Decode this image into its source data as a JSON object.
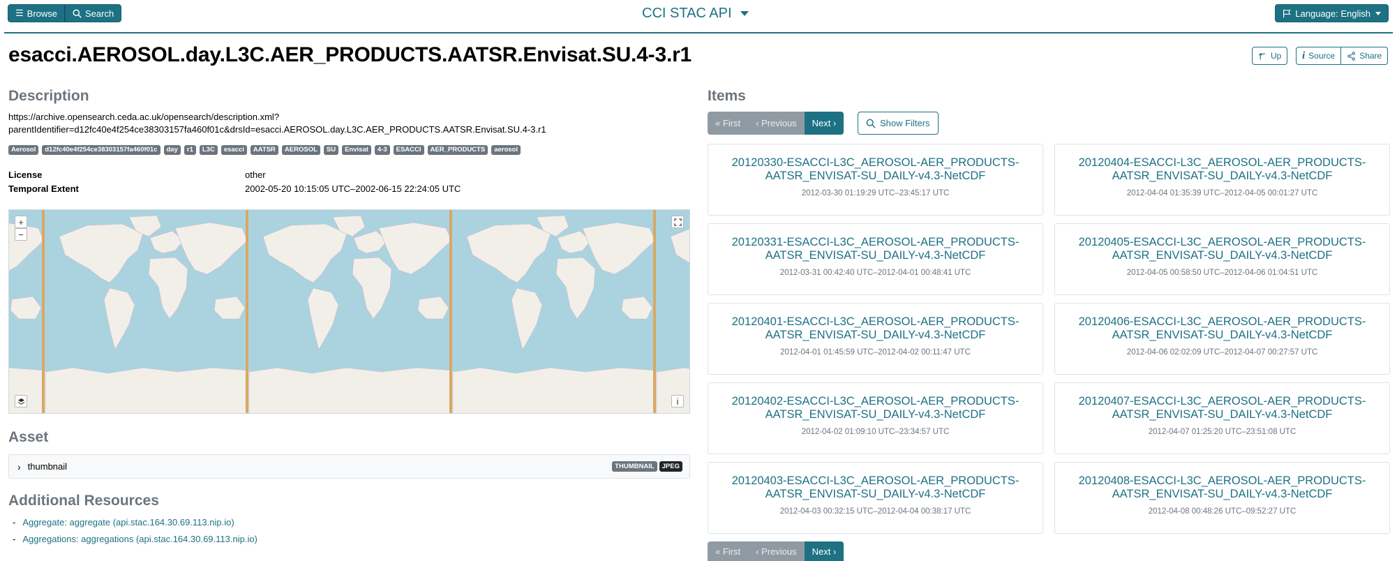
{
  "header": {
    "browse_label": "Browse",
    "search_label": "Search",
    "app_title": "CCI STAC API",
    "language_label": "Language: English"
  },
  "page": {
    "title": "esacci.AEROSOL.day.L3C.AER_PRODUCTS.AATSR.Envisat.SU.4-3.r1",
    "up_label": "Up",
    "source_label": "Source",
    "share_label": "Share"
  },
  "description": {
    "heading": "Description",
    "line1": "https://archive.opensearch.ceda.ac.uk/opensearch/description.xml?",
    "line2": "parentIdentifier=d12fc40e4f254ce38303157fa460f01c&drsId=esacci.AEROSOL.day.L3C.AER_PRODUCTS.AATSR.Envisat.SU.4-3.r1",
    "keywords": [
      "Aerosol",
      "d12fc40e4f254ce38303157fa460f01c",
      "day",
      "r1",
      "L3C",
      "esacci",
      "AATSR",
      "AEROSOL",
      "SU",
      "Envisat",
      "4-3",
      "ESACCI",
      "AER_PRODUCTS",
      "aerosol"
    ]
  },
  "meta": {
    "license_label": "License",
    "license_value": "other",
    "temporal_label": "Temporal Extent",
    "temporal_value": "2002-05-20 10:15:05 UTC–2002-06-15 22:24:05 UTC"
  },
  "map": {
    "zoom_in": "+",
    "zoom_out": "−",
    "info": "i"
  },
  "asset": {
    "heading": "Asset",
    "name": "thumbnail",
    "role_badge": "THUMBNAIL",
    "type_badge": "JPEG"
  },
  "resources": {
    "heading": "Additional Resources",
    "links": [
      "Aggregate: aggregate (api.stac.164.30.69.113.nip.io)",
      "Aggregations: aggregations (api.stac.164.30.69.113.nip.io)"
    ]
  },
  "items": {
    "heading": "Items",
    "first_label": "« First",
    "previous_label": "‹ Previous",
    "next_label": "Next ›",
    "show_filters_label": "Show Filters",
    "list": [
      {
        "title": "20120330-ESACCI-L3C_AEROSOL-AER_PRODUCTS-AATSR_ENVISAT-SU_DAILY-v4.3-NetCDF",
        "time": "2012-03-30 01:19:29 UTC–23:45:17 UTC"
      },
      {
        "title": "20120404-ESACCI-L3C_AEROSOL-AER_PRODUCTS-AATSR_ENVISAT-SU_DAILY-v4.3-NetCDF",
        "time": "2012-04-04 01:35:39 UTC–2012-04-05 00:01:27 UTC"
      },
      {
        "title": "20120331-ESACCI-L3C_AEROSOL-AER_PRODUCTS-AATSR_ENVISAT-SU_DAILY-v4.3-NetCDF",
        "time": "2012-03-31 00:42:40 UTC–2012-04-01 00:48:41 UTC"
      },
      {
        "title": "20120405-ESACCI-L3C_AEROSOL-AER_PRODUCTS-AATSR_ENVISAT-SU_DAILY-v4.3-NetCDF",
        "time": "2012-04-05 00:58:50 UTC–2012-04-06 01:04:51 UTC"
      },
      {
        "title": "20120401-ESACCI-L3C_AEROSOL-AER_PRODUCTS-AATSR_ENVISAT-SU_DAILY-v4.3-NetCDF",
        "time": "2012-04-01 01:45:59 UTC–2012-04-02 00:11:47 UTC"
      },
      {
        "title": "20120406-ESACCI-L3C_AEROSOL-AER_PRODUCTS-AATSR_ENVISAT-SU_DAILY-v4.3-NetCDF",
        "time": "2012-04-06 02:02:09 UTC–2012-04-07 00:27:57 UTC"
      },
      {
        "title": "20120402-ESACCI-L3C_AEROSOL-AER_PRODUCTS-AATSR_ENVISAT-SU_DAILY-v4.3-NetCDF",
        "time": "2012-04-02 01:09:10 UTC–23:34:57 UTC"
      },
      {
        "title": "20120407-ESACCI-L3C_AEROSOL-AER_PRODUCTS-AATSR_ENVISAT-SU_DAILY-v4.3-NetCDF",
        "time": "2012-04-07 01:25:20 UTC–23:51:08 UTC"
      },
      {
        "title": "20120403-ESACCI-L3C_AEROSOL-AER_PRODUCTS-AATSR_ENVISAT-SU_DAILY-v4.3-NetCDF",
        "time": "2012-04-03 00:32:15 UTC–2012-04-04 00:38:17 UTC"
      },
      {
        "title": "20120408-ESACCI-L3C_AEROSOL-AER_PRODUCTS-AATSR_ENVISAT-SU_DAILY-v4.3-NetCDF",
        "time": "2012-04-08 00:48:26 UTC–09:52:27 UTC"
      }
    ]
  }
}
